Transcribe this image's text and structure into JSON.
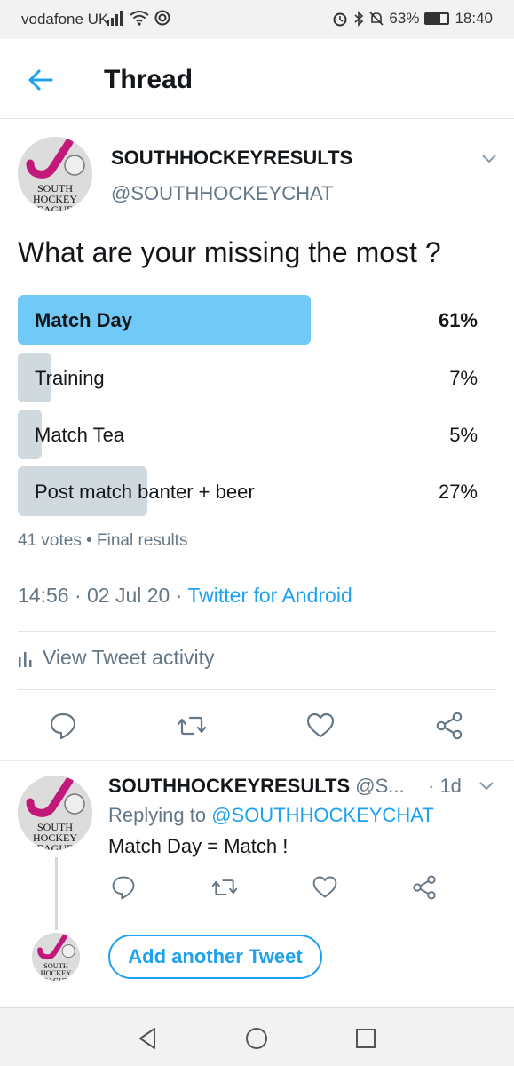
{
  "status_bar": {
    "carrier": "vodafone UK",
    "battery": "63%",
    "battery_level": 0.63,
    "time": "18:40",
    "icons": [
      "signal-icon",
      "wifi-icon",
      "nfc-icon",
      "alarm-icon",
      "bluetooth-icon",
      "mute-icon",
      "battery-icon"
    ]
  },
  "header": {
    "title": "Thread",
    "back_icon": "back-arrow-icon"
  },
  "tweet": {
    "author_name": "SOUTHHOCKEYRESULTS",
    "author_handle": "@SOUTHHOCKEYCHAT",
    "avatar_text": [
      "SOUTH",
      "HOCKEY",
      "EAGUE"
    ],
    "text": "What are your missing the most ?",
    "poll": {
      "options": [
        {
          "label": "Match Day",
          "percent": "61%",
          "value": 61,
          "winner": true
        },
        {
          "label": "Training",
          "percent": "7%",
          "value": 7,
          "winner": false
        },
        {
          "label": "Match Tea",
          "percent": "5%",
          "value": 5,
          "winner": false
        },
        {
          "label": "Post match banter + beer",
          "percent": "27%",
          "value": 27,
          "winner": false
        }
      ],
      "meta": "41 votes • Final results"
    },
    "timestamp": "14:56 · 02 Jul 20 · ",
    "source": "Twitter for Android",
    "activity_label": "View Tweet activity",
    "actions": [
      "reply-icon",
      "retweet-icon",
      "like-icon",
      "share-icon"
    ]
  },
  "reply": {
    "author_name": "SOUTHHOCKEYRESULTS",
    "handle_truncated": "@S...",
    "time": "· 1d",
    "replying_prefix": "Replying to ",
    "replying_to": "@SOUTHHOCKEYCHAT",
    "text": "Match Day = Match !"
  },
  "compose": {
    "add_label": "Add another Tweet"
  },
  "nav": {
    "buttons": [
      "nav-back-icon",
      "nav-home-icon",
      "nav-recents-icon"
    ]
  },
  "colors": {
    "accent": "#1da1f2",
    "poll_winner": "#71c9f8",
    "poll_other": "#cfd9de",
    "logo_magenta": "#c2187a"
  }
}
